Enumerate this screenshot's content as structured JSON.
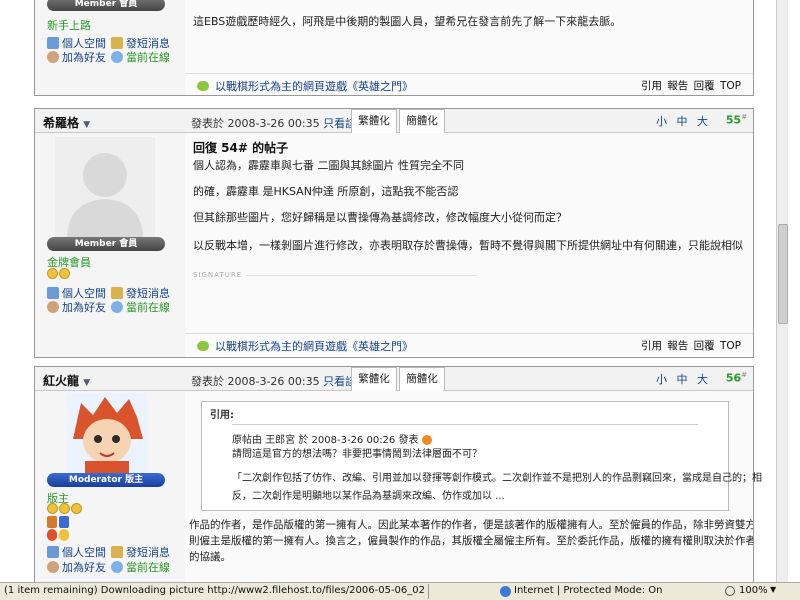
{
  "post1": {
    "content_line": "這EBS遊戲歷時經久，阿飛是中後期的製圖人員，望希兄在發言前先了解一下來龍去脈。",
    "badge": "Member 會員",
    "rank": "新手上路",
    "links": [
      "個人空間",
      "發短消息",
      "加為好友",
      "當前在線"
    ],
    "ad_text": "以戰棋形式為主的網頁遊戲《英雄之門》",
    "actions": "引用 報告 回覆 TOP"
  },
  "post2": {
    "author": "希羅格",
    "dropdown": "▼",
    "posted": "發表於 2008-3-26 00:35",
    "only_author": "只看該作者",
    "tab_trad": "繁體化",
    "tab_simp": "簡體化",
    "font_sizes": "小 中 大",
    "floor": "55",
    "floor_suffix": "#",
    "badge": "Member 會員",
    "rank": "金牌會員",
    "title": "回復 54# 的帖子",
    "lines": [
      "個人認為，霹靂車與七番 二圖與其餘圖片 性質完全不同",
      "的確，霹靂車 是HKSAN仲達 所原創，這點我不能否認",
      "但其餘那些圖片，您好歸稱是以曹操傳為基調修改，修改幅度大小從何而定？",
      "以反戰本增，一樣剝圖片進行修改，亦表明取存於曹操傳，暫時不覺得與閣下所提供網址中有何關連，只能說相似"
    ],
    "signature": "SIGNATURE",
    "links": [
      "個人空間",
      "發短消息",
      "加為好友",
      "當前在線"
    ],
    "ad_text": "以戰棋形式為主的網頁遊戲《英雄之門》",
    "actions": "引用 報告 回覆 TOP"
  },
  "post3": {
    "author": "紅火龍",
    "dropdown": "▼",
    "posted": "發表於 2008-3-26 00:35",
    "only_author": "只看該作者",
    "tab_trad": "繁體化",
    "tab_simp": "簡體化",
    "font_sizes": "小 中 大",
    "floor": "56",
    "floor_suffix": "#",
    "badge": "Moderator 版主",
    "rank": "版主",
    "quote_label": "引用:",
    "quote_author_line": "原帖由 王郎宮 於 2008-3-26 00:26 發表",
    "quote_line1": "請問這是官方的想法嗎？非要把事情鬧到法律層面不可？",
    "quote_line2": "「二次創作包括了仿作、改編、引用並加以發揮等創作模式。二次創作並不是把別人的作品剽竊回來，當成是自己的；相",
    "quote_line3": "反，二次創作是明顯地以某作品為基調來改編、仿作或加以 ...",
    "body_lines": [
      "作品的作者，是作品版權的第一擁有人。因此某本著作的作者，便是該著作的版權擁有人。至於僱員的作品，除非勞資雙方另有協議，否",
      "則僱主是版權的第一擁有人。換言之，僱員製作的作品，其版權全屬僱主所有。至於委託作品，版權的擁有權則取決於作者與委託人之間",
      "的協議。"
    ],
    "links": [
      "個人空間",
      "發短消息",
      "加為好友",
      "當前在線"
    ]
  },
  "statusbar": {
    "download": "(1 item remaining) Downloading picture http://www2.filehost.to/files/2006-05-06_02/1",
    "zone": "Internet | Protected Mode: On",
    "zoom": "100%"
  },
  "colors": {
    "link": "#14428a",
    "green": "#2a9a2a",
    "member_badge": "#555555",
    "moderator_badge": "#1b3f9b"
  }
}
